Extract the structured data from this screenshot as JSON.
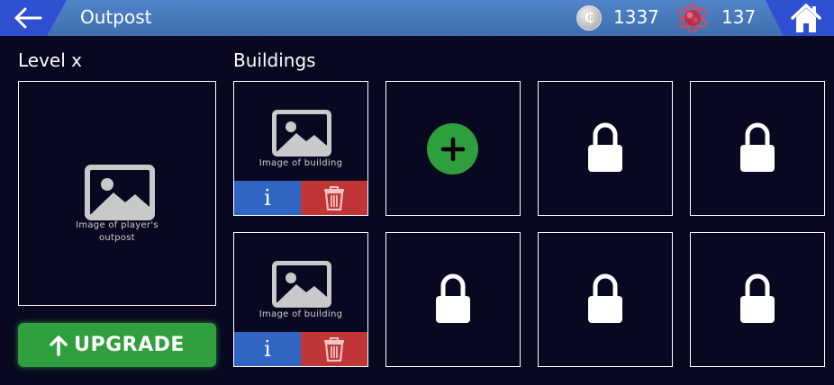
{
  "header": {
    "title": "Outpost",
    "coins": "1337",
    "coin_symbol": "₵",
    "atoms": "137",
    "icons": {
      "back": "back-arrow-icon",
      "coin": "coin-icon",
      "atom": "atom-icon",
      "home": "home-icon"
    }
  },
  "outpost": {
    "level_label": "Level x",
    "image_caption_line1": "Image of player's",
    "image_caption_line2": "outpost",
    "upgrade_label": "UPGRADE"
  },
  "buildings": {
    "section_label": "Buildings",
    "occupied": [
      {
        "caption": "Image of building",
        "info_label": "i"
      },
      {
        "caption": "Image of building",
        "info_label": "i"
      }
    ],
    "empty_slot_icon": "plus-icon",
    "locked_slot_icon": "lock-icon"
  },
  "colors": {
    "background": "#080820",
    "header": "#4f84c6",
    "header_caps": "#2e4fcf",
    "upgrade_green": "#2f9e3c",
    "info_blue": "#3165c4",
    "delete_red": "#c03535"
  }
}
